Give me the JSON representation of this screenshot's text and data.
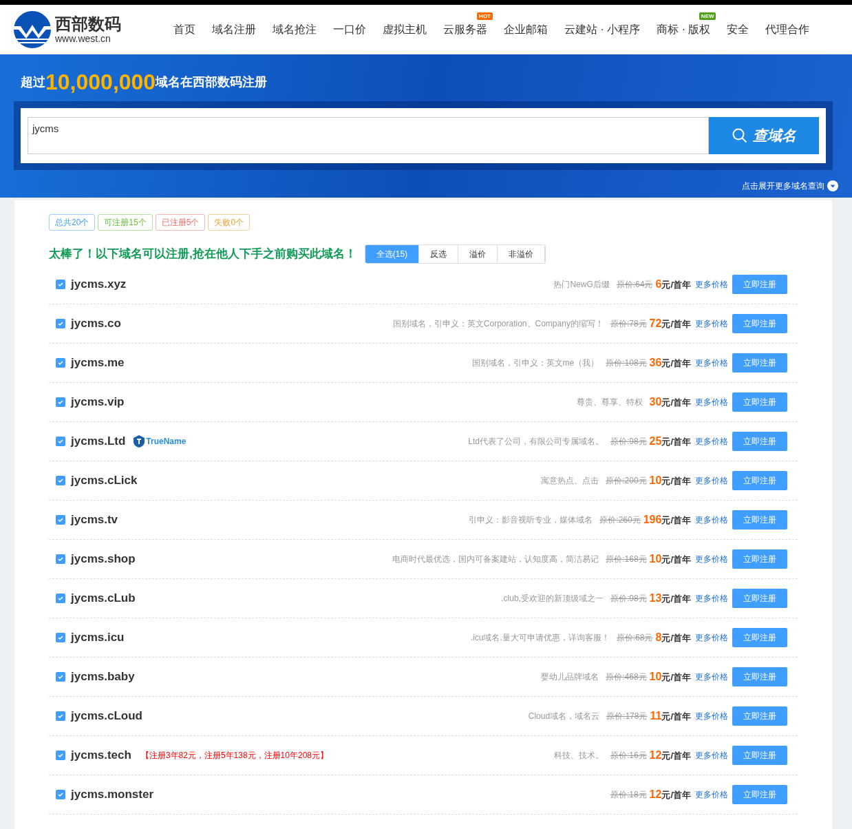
{
  "logo": {
    "name": "西部数码",
    "url": "www.west.cn"
  },
  "nav": [
    {
      "label": "首页"
    },
    {
      "label": "域名注册"
    },
    {
      "label": "域名抢注"
    },
    {
      "label": "一口价"
    },
    {
      "label": "虚拟主机"
    },
    {
      "label": "云服务器",
      "badge": {
        "text": "HOT",
        "color": "#ff6a00"
      }
    },
    {
      "label": "企业邮箱"
    },
    {
      "label": "云建站 · 小程序"
    },
    {
      "label": "商标 · 版权",
      "badge": {
        "text": "NEW",
        "color": "#52a01a"
      }
    },
    {
      "label": "安全"
    },
    {
      "label": "代理合作"
    }
  ],
  "banner": {
    "prefix": "超过",
    "number": "10,000,000",
    "suffix": "域名在西部数码注册",
    "search_value": "jycms",
    "search_button": "查域名",
    "expand_link": "点击展开更多域名查询"
  },
  "summary_tags": [
    {
      "label": "总共20个",
      "color": "#409eff"
    },
    {
      "label": "可注册15个",
      "color": "#67c23a"
    },
    {
      "label": "已注册5个",
      "color": "#f56c6c"
    },
    {
      "label": "失败0个",
      "color": "#e6a23c"
    }
  ],
  "headline": "太棒了！以下域名可以注册,抢在他人下手之前购买此域名！",
  "filters": [
    {
      "label": "全选(15)",
      "selected": true
    },
    {
      "label": "反选",
      "selected": false
    },
    {
      "label": "溢价",
      "selected": false
    },
    {
      "label": "非溢价",
      "selected": false
    }
  ],
  "domains": [
    {
      "name": "jycms.xyz",
      "checked": true,
      "desc": "热门NewG后缀",
      "original": "原价:64元",
      "price": "6",
      "unit": "元/首年",
      "more": "更多价格",
      "button": "立即注册"
    },
    {
      "name": "jycms.co",
      "checked": true,
      "desc": "国别域名，引申义：英文Corporation、Company的缩写！",
      "original": "原价:78元",
      "price": "72",
      "unit": "元/首年",
      "more": "更多价格",
      "button": "立即注册"
    },
    {
      "name": "jycms.me",
      "checked": true,
      "desc": "国别域名，引申义：英文me（我）",
      "original": "原价:108元",
      "price": "36",
      "unit": "元/首年",
      "more": "更多价格",
      "button": "立即注册"
    },
    {
      "name": "jycms.vip",
      "checked": true,
      "desc": "尊贵、尊享、特权",
      "price": "30",
      "unit": "元/首年",
      "more": "更多价格",
      "button": "立即注册"
    },
    {
      "name": "jycms.Ltd",
      "checked": true,
      "brand": "TrueName",
      "desc": "Ltd代表了公司，有限公司专属域名。",
      "original": "原价:98元",
      "price": "25",
      "unit": "元/首年",
      "more": "更多价格",
      "button": "立即注册"
    },
    {
      "name": "jycms.cLick",
      "checked": true,
      "desc": "寓意热点、点击",
      "original": "原价:200元",
      "price": "10",
      "unit": "元/首年",
      "more": "更多价格",
      "button": "立即注册"
    },
    {
      "name": "jycms.tv",
      "checked": true,
      "desc": "引申义：影音视听专业，媒体域名",
      "original": "原价:260元",
      "price": "196",
      "unit": "元/首年",
      "more": "更多价格",
      "button": "立即注册"
    },
    {
      "name": "jycms.shop",
      "checked": true,
      "desc": "电商时代最优选，国内可备案建站，认知度高，简洁易记",
      "original": "原价:168元",
      "price": "10",
      "unit": "元/首年",
      "more": "更多价格",
      "button": "立即注册"
    },
    {
      "name": "jycms.cLub",
      "checked": true,
      "desc": ".club,受欢迎的新顶级域之一",
      "original": "原价:98元",
      "price": "13",
      "unit": "元/首年",
      "more": "更多价格",
      "button": "立即注册"
    },
    {
      "name": "jycms.icu",
      "checked": true,
      "desc": ".icu域名.量大可申请优惠，详询客服！",
      "original": "原价:68元",
      "price": "8",
      "unit": "元/首年",
      "more": "更多价格",
      "button": "立即注册"
    },
    {
      "name": "jycms.baby",
      "checked": true,
      "desc": "婴幼儿品牌域名",
      "original": "原价:468元",
      "price": "10",
      "unit": "元/首年",
      "more": "更多价格",
      "button": "立即注册"
    },
    {
      "name": "jycms.cLoud",
      "checked": true,
      "desc": "Cloud域名，域名云",
      "original": "原价:178元",
      "price": "11",
      "unit": "元/首年",
      "more": "更多价格",
      "button": "立即注册"
    },
    {
      "name": "jycms.tech",
      "checked": true,
      "promo": "【注册3年82元，注册5年138元，注册10年208元】",
      "desc": "科技、技术。",
      "original": "原价:16元",
      "price": "12",
      "unit": "元/首年",
      "more": "更多价格",
      "button": "立即注册"
    },
    {
      "name": "jycms.monster",
      "checked": true,
      "original": "原价:18元",
      "price": "12",
      "unit": "元/首年",
      "more": "更多价格",
      "button": "立即注册"
    }
  ]
}
